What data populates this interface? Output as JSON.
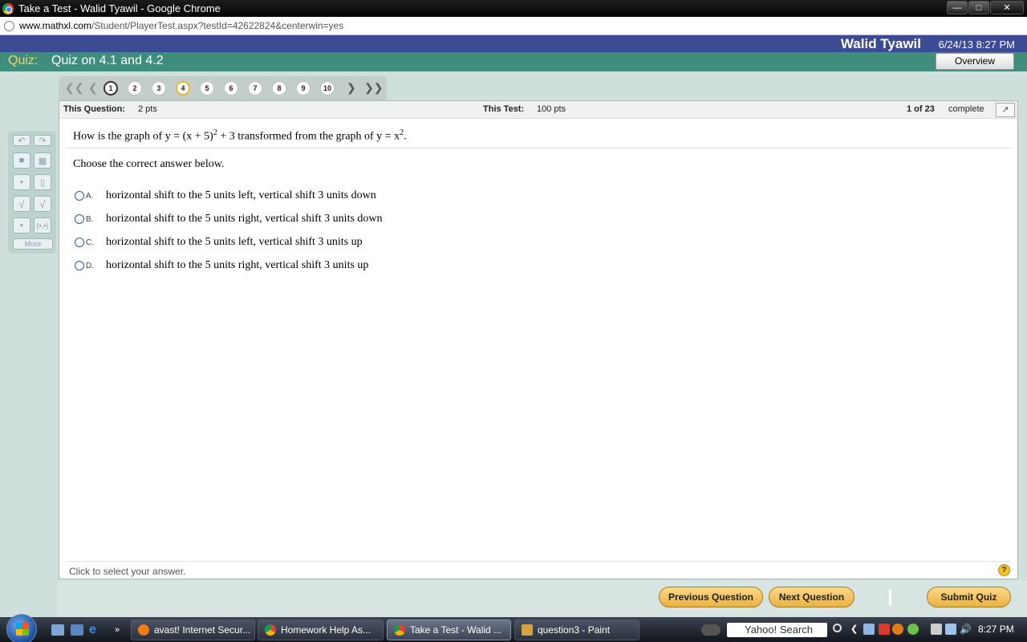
{
  "browser": {
    "window_title": "Take a Test - Walid Tyawil - Google Chrome",
    "url_domain": "www.mathxl.com",
    "url_path": "/Student/PlayerTest.aspx?testId=42622824&centerwin=yes",
    "window_controls": [
      "minimize",
      "maximize",
      "close"
    ]
  },
  "header": {
    "user_name": "Walid Tyawil",
    "datetime": "6/24/13 8:27 PM",
    "quiz_label": "Quiz:",
    "quiz_name": "Quiz on 4.1 and 4.2",
    "overview_label": "Overview"
  },
  "question_nav": {
    "numbers": [
      "1",
      "2",
      "3",
      "4",
      "5",
      "6",
      "7",
      "8",
      "9",
      "10"
    ],
    "current": "1",
    "flagged": "4",
    "first_icon": "double-left-arrow",
    "prev_icon": "left-arrow",
    "next_icon": "right-arrow",
    "last_icon": "double-right-arrow"
  },
  "question_info": {
    "this_question_label": "This Question:",
    "this_question_pts": "2 pts",
    "this_test_label": "This Test:",
    "this_test_pts": "100 pts",
    "progress": "1 of 23",
    "complete": "complete"
  },
  "question": {
    "text_prefix": "How is the graph of y = (x + 5)",
    "exp1": "2",
    "text_middle": " + 3 transformed from the graph of y = x",
    "exp2": "2",
    "text_suffix": ".",
    "instruction": "Choose the correct answer below.",
    "choices": [
      {
        "letter": "A.",
        "text": "horizontal shift to the 5 units left, vertical shift 3 units down"
      },
      {
        "letter": "B.",
        "text": "horizontal shift to the 5 units right, vertical shift 3 units down"
      },
      {
        "letter": "C.",
        "text": "horizontal shift to the 5 units left, vertical shift 3 units up"
      },
      {
        "letter": "D.",
        "text": "horizontal shift to the 5 units right, vertical shift 3 units up"
      }
    ]
  },
  "footer": {
    "status": "Click to select your answer.",
    "help": "?",
    "prev_button": "Previous Question",
    "next_button": "Next Question",
    "submit_button": "Submit Quiz"
  },
  "palette": {
    "more_label": "More"
  },
  "taskbar": {
    "tasks": [
      {
        "label": "avast! Internet Secur..."
      },
      {
        "label": "Homework Help As..."
      },
      {
        "label": "Take a Test - Walid ..."
      },
      {
        "label": "question3 - Paint"
      }
    ],
    "search_label": "Yahoo! Search",
    "clock": "8:27 PM"
  }
}
